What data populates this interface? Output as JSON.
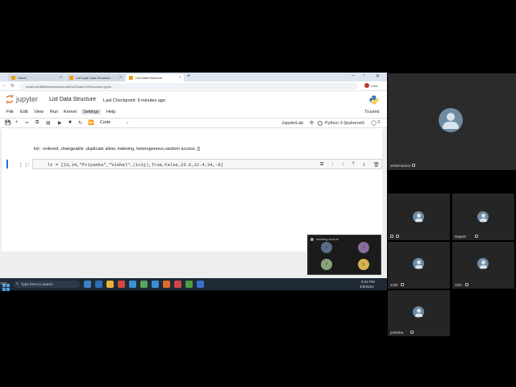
{
  "browser": {
    "tabs": [
      {
        "label": "Home"
      },
      {
        "label": "List tuple Data Structure"
      },
      {
        "label": "List Data Structure"
      }
    ],
    "new_tab": "+",
    "url": "localhost:8888/notebooks/Lists%20Data%20Structure.ipynb",
    "profile_label": "Chat"
  },
  "jupyter": {
    "brand": "jupyter",
    "notebook_title": "List Data Structure",
    "checkpoint": "Last Checkpoint: 9 minutes ago",
    "menu": [
      "File",
      "Edit",
      "View",
      "Run",
      "Kernel",
      "Settings",
      "Help"
    ],
    "trusted": "Trusted",
    "cell_type": "Code",
    "jupyterlab_label": "JupyterLab",
    "kernel_label": "Python 3 (ipykernel)",
    "markdown_cell": "list : ordered, changeable ,duplicate allow, indexing, heterogenous,random access, []",
    "code_prompt": "[ ]:",
    "code_cell": "lt = [23,34,\"Priyanka\",\"Vishal\",(1+3j),True,False,25.6,22.4,34,-9]"
  },
  "taskbar": {
    "search_placeholder": "Type here to search",
    "time": "9:22 PM",
    "date": "4/5/2024"
  },
  "meeting": {
    "main_participant": "vishal kumar",
    "participants": [
      "Rajesh",
      "srish",
      "Vinh",
      "preksha"
    ],
    "mini_title": "meeting.zoho.in",
    "mini_initials": [
      "V",
      "V",
      "P",
      "S"
    ],
    "strip_label": "Vish"
  }
}
